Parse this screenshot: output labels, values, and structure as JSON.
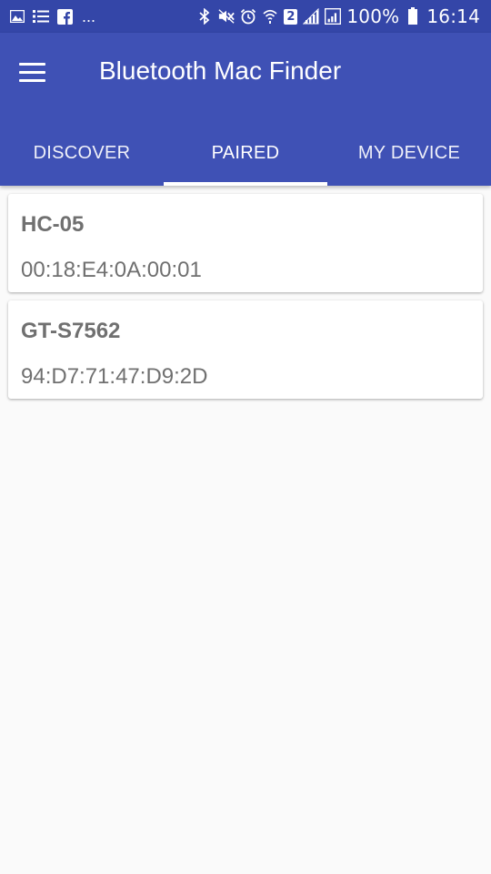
{
  "status_bar": {
    "left_icons": [
      "gallery-icon",
      "list-icon",
      "facebook-icon"
    ],
    "overflow": "...",
    "right_icons": [
      "bluetooth-icon",
      "mute-icon",
      "alarm-icon",
      "wifi-icon",
      "sim-icon",
      "signal-icon",
      "signal-icon",
      "battery-icon"
    ],
    "sim_number": "2",
    "battery_percent": "100%",
    "time": "16:14"
  },
  "app_bar": {
    "title": "Bluetooth Mac Finder",
    "menu_icon": "hamburger-menu-icon",
    "accent_color": "#3f51b5",
    "status_color": "#3446a8"
  },
  "tabs": [
    {
      "label": "DISCOVER",
      "active": false
    },
    {
      "label": "PAIRED",
      "active": true
    },
    {
      "label": "MY DEVICE",
      "active": false
    }
  ],
  "devices": [
    {
      "name": "HC-05",
      "mac": "00:18:E4:0A:00:01"
    },
    {
      "name": "GT-S7562",
      "mac": "94:D7:71:47:D9:2D"
    }
  ]
}
